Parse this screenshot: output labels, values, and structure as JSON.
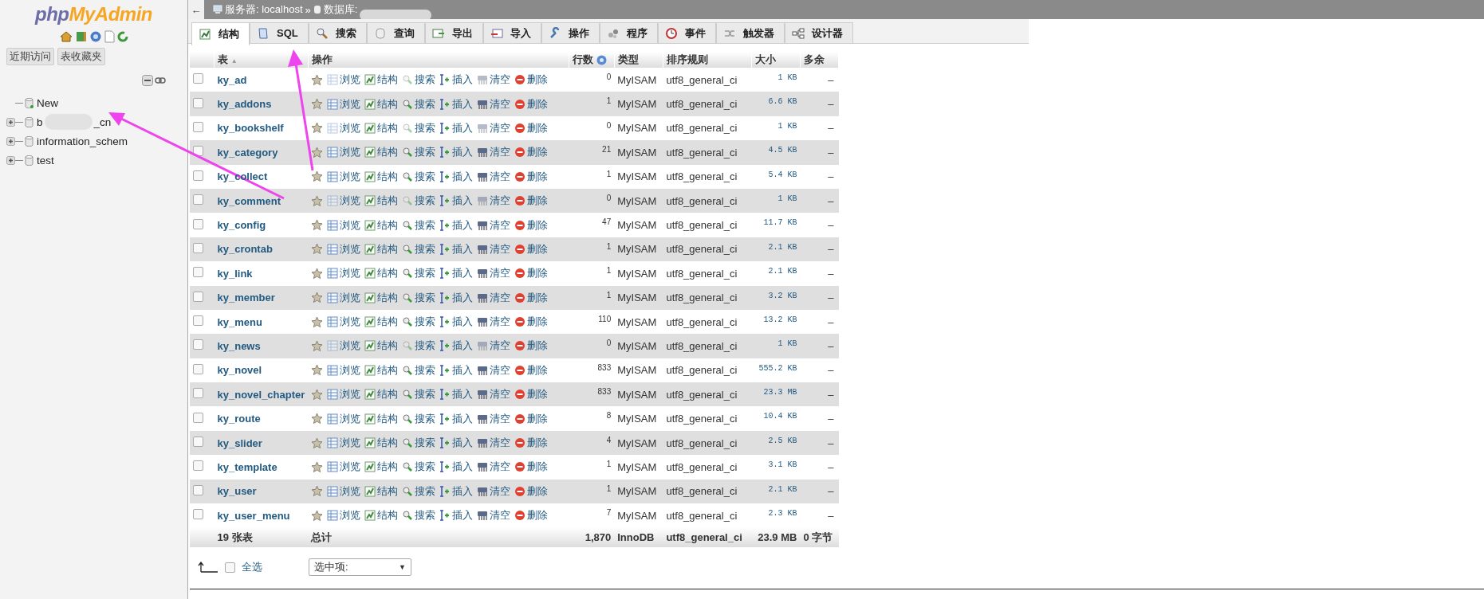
{
  "sidebar": {
    "logo": {
      "part1": "php",
      "part2": "MyAdmin"
    },
    "buttons": [
      {
        "label": "近期访问"
      },
      {
        "label": "表收藏夹"
      }
    ],
    "tree": [
      {
        "label": "New",
        "kind": "new"
      },
      {
        "label": "b",
        "label_end": "_cn",
        "kind": "db",
        "blurred": true
      },
      {
        "label": "information_schem",
        "kind": "db"
      },
      {
        "label": "test",
        "kind": "db"
      }
    ]
  },
  "breadcrumb": {
    "back": "←",
    "server": "服务器: localhost",
    "separator": "»",
    "database": "数据库:"
  },
  "tabs": [
    {
      "label": "结构",
      "selected": true
    },
    {
      "label": "SQL",
      "selected": false
    },
    {
      "label": "搜索",
      "selected": false
    },
    {
      "label": "查询",
      "selected": false
    },
    {
      "label": "导出",
      "selected": false
    },
    {
      "label": "导入",
      "selected": false
    },
    {
      "label": "操作",
      "selected": false
    },
    {
      "label": "程序",
      "selected": false
    },
    {
      "label": "事件",
      "selected": false
    },
    {
      "label": "触发器",
      "selected": false
    },
    {
      "label": "设计器",
      "selected": false
    }
  ],
  "table": {
    "columns": [
      "表",
      "操作",
      "行数",
      "类型",
      "排序规则",
      "大小",
      "多余"
    ],
    "sort_glyph": "▲",
    "rows": [
      {
        "name": "ky_ad",
        "checked": false,
        "rows": "0",
        "type": "MyISAM",
        "collation": "utf8_general_ci",
        "size": "1 KB",
        "overhead": "–",
        "empty": true,
        "actions": [
          "浏览",
          "结构",
          "搜索",
          "插入",
          "清空",
          "删除"
        ]
      },
      {
        "name": "ky_addons",
        "checked": false,
        "rows": "1",
        "type": "MyISAM",
        "collation": "utf8_general_ci",
        "size": "6.6 KB",
        "overhead": "–",
        "empty": false,
        "actions": [
          "浏览",
          "结构",
          "搜索",
          "插入",
          "清空",
          "删除"
        ]
      },
      {
        "name": "ky_bookshelf",
        "checked": false,
        "rows": "0",
        "type": "MyISAM",
        "collation": "utf8_general_ci",
        "size": "1 KB",
        "overhead": "–",
        "empty": true,
        "actions": [
          "浏览",
          "结构",
          "搜索",
          "插入",
          "清空",
          "删除"
        ]
      },
      {
        "name": "ky_category",
        "checked": false,
        "rows": "21",
        "type": "MyISAM",
        "collation": "utf8_general_ci",
        "size": "4.5 KB",
        "overhead": "–",
        "empty": false,
        "actions": [
          "浏览",
          "结构",
          "搜索",
          "插入",
          "清空",
          "删除"
        ]
      },
      {
        "name": "ky_collect",
        "checked": false,
        "rows": "1",
        "type": "MyISAM",
        "collation": "utf8_general_ci",
        "size": "5.4 KB",
        "overhead": "–",
        "empty": false,
        "actions": [
          "浏览",
          "结构",
          "搜索",
          "插入",
          "清空",
          "删除"
        ]
      },
      {
        "name": "ky_comment",
        "checked": false,
        "rows": "0",
        "type": "MyISAM",
        "collation": "utf8_general_ci",
        "size": "1 KB",
        "overhead": "–",
        "empty": true,
        "actions": [
          "浏览",
          "结构",
          "搜索",
          "插入",
          "清空",
          "删除"
        ]
      },
      {
        "name": "ky_config",
        "checked": false,
        "rows": "47",
        "type": "MyISAM",
        "collation": "utf8_general_ci",
        "size": "11.7 KB",
        "overhead": "–",
        "empty": false,
        "actions": [
          "浏览",
          "结构",
          "搜索",
          "插入",
          "清空",
          "删除"
        ]
      },
      {
        "name": "ky_crontab",
        "checked": false,
        "rows": "1",
        "type": "MyISAM",
        "collation": "utf8_general_ci",
        "size": "2.1 KB",
        "overhead": "–",
        "empty": false,
        "actions": [
          "浏览",
          "结构",
          "搜索",
          "插入",
          "清空",
          "删除"
        ]
      },
      {
        "name": "ky_link",
        "checked": false,
        "rows": "1",
        "type": "MyISAM",
        "collation": "utf8_general_ci",
        "size": "2.1 KB",
        "overhead": "–",
        "empty": false,
        "actions": [
          "浏览",
          "结构",
          "搜索",
          "插入",
          "清空",
          "删除"
        ]
      },
      {
        "name": "ky_member",
        "checked": false,
        "rows": "1",
        "type": "MyISAM",
        "collation": "utf8_general_ci",
        "size": "3.2 KB",
        "overhead": "–",
        "empty": false,
        "actions": [
          "浏览",
          "结构",
          "搜索",
          "插入",
          "清空",
          "删除"
        ]
      },
      {
        "name": "ky_menu",
        "checked": false,
        "rows": "110",
        "type": "MyISAM",
        "collation": "utf8_general_ci",
        "size": "13.2 KB",
        "overhead": "–",
        "empty": false,
        "actions": [
          "浏览",
          "结构",
          "搜索",
          "插入",
          "清空",
          "删除"
        ]
      },
      {
        "name": "ky_news",
        "checked": false,
        "rows": "0",
        "type": "MyISAM",
        "collation": "utf8_general_ci",
        "size": "1 KB",
        "overhead": "–",
        "empty": true,
        "actions": [
          "浏览",
          "结构",
          "搜索",
          "插入",
          "清空",
          "删除"
        ]
      },
      {
        "name": "ky_novel",
        "checked": false,
        "rows": "833",
        "type": "MyISAM",
        "collation": "utf8_general_ci",
        "size": "555.2 KB",
        "overhead": "–",
        "empty": false,
        "actions": [
          "浏览",
          "结构",
          "搜索",
          "插入",
          "清空",
          "删除"
        ]
      },
      {
        "name": "ky_novel_chapter",
        "checked": false,
        "rows": "833",
        "type": "MyISAM",
        "collation": "utf8_general_ci",
        "size": "23.3 MB",
        "overhead": "–",
        "empty": false,
        "actions": [
          "浏览",
          "结构",
          "搜索",
          "插入",
          "清空",
          "删除"
        ]
      },
      {
        "name": "ky_route",
        "checked": false,
        "rows": "8",
        "type": "MyISAM",
        "collation": "utf8_general_ci",
        "size": "10.4 KB",
        "overhead": "–",
        "empty": false,
        "actions": [
          "浏览",
          "结构",
          "搜索",
          "插入",
          "清空",
          "删除"
        ]
      },
      {
        "name": "ky_slider",
        "checked": false,
        "rows": "4",
        "type": "MyISAM",
        "collation": "utf8_general_ci",
        "size": "2.5 KB",
        "overhead": "–",
        "empty": false,
        "actions": [
          "浏览",
          "结构",
          "搜索",
          "插入",
          "清空",
          "删除"
        ]
      },
      {
        "name": "ky_template",
        "checked": false,
        "rows": "1",
        "type": "MyISAM",
        "collation": "utf8_general_ci",
        "size": "3.1 KB",
        "overhead": "–",
        "empty": false,
        "actions": [
          "浏览",
          "结构",
          "搜索",
          "插入",
          "清空",
          "删除"
        ]
      },
      {
        "name": "ky_user",
        "checked": false,
        "rows": "1",
        "type": "MyISAM",
        "collation": "utf8_general_ci",
        "size": "2.1 KB",
        "overhead": "–",
        "empty": false,
        "actions": [
          "浏览",
          "结构",
          "搜索",
          "插入",
          "清空",
          "删除"
        ]
      },
      {
        "name": "ky_user_menu",
        "checked": false,
        "rows": "7",
        "type": "MyISAM",
        "collation": "utf8_general_ci",
        "size": "2.3 KB",
        "overhead": "–",
        "empty": false,
        "actions": [
          "浏览",
          "结构",
          "搜索",
          "插入",
          "清空",
          "删除"
        ]
      }
    ],
    "footer": {
      "count": "19 张表",
      "label": "总计",
      "rows": "1,870",
      "type": "InnoDB",
      "collation": "utf8_general_ci",
      "size": "23.9 MB",
      "overhead": "0 字节"
    }
  },
  "bulk": {
    "check_all": "全选",
    "checked": false,
    "select": "选中项:",
    "select_caret": "▼"
  }
}
